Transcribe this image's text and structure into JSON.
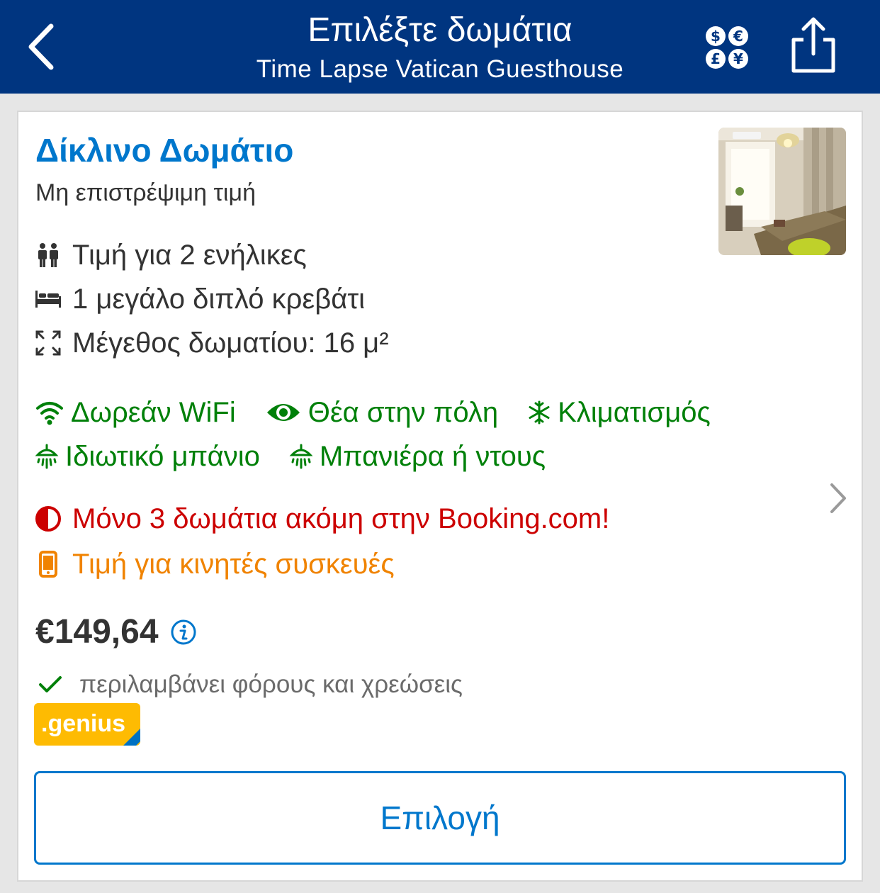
{
  "navbar": {
    "title": "Επιλέξτε δωμάτια",
    "subtitle": "Time Lapse Vatican Guesthouse",
    "back_icon": "chevron-left-icon",
    "currency_icon": "currency-exchange-icon",
    "share_icon": "share-icon"
  },
  "room": {
    "name": "Δίκλινο Δωμάτιο",
    "policy": "Μη επιστρέψιμη τιμή",
    "facts": [
      {
        "icon": "guests-icon",
        "text": "Τιμή για 2 ενήλικες"
      },
      {
        "icon": "bed-icon",
        "text": "1 μεγάλο διπλό κρεβάτι"
      },
      {
        "icon": "room-size-icon",
        "text": "Μέγεθος δωματίου: 16 μ²"
      }
    ],
    "amenities": [
      {
        "icon": "wifi-icon",
        "text": "Δωρεάν WiFi"
      },
      {
        "icon": "eye-icon",
        "text": "Θέα στην πόλη"
      },
      {
        "icon": "snowflake-icon",
        "text": "Κλιματισμός"
      },
      {
        "icon": "shower-icon",
        "text": "Ιδιωτικό μπάνιο"
      },
      {
        "icon": "shower-icon",
        "text": "Μπανιέρα ή ντους"
      }
    ],
    "urgency": "Μόνο 3 δωμάτια ακόμη στην Booking.com!",
    "mobile_price": "Τιμή για κινητές συσκευές",
    "price": "€149,64",
    "taxes_note": "περιλαμβάνει φόρους και χρεώσεις",
    "genius_label": ".genius",
    "select_label": "Επιλογή"
  },
  "colors": {
    "brand": "#003580",
    "link": "#0077cc",
    "green": "#008009",
    "red": "#cc0000",
    "orange": "#f08300",
    "genius": "#febb02"
  }
}
